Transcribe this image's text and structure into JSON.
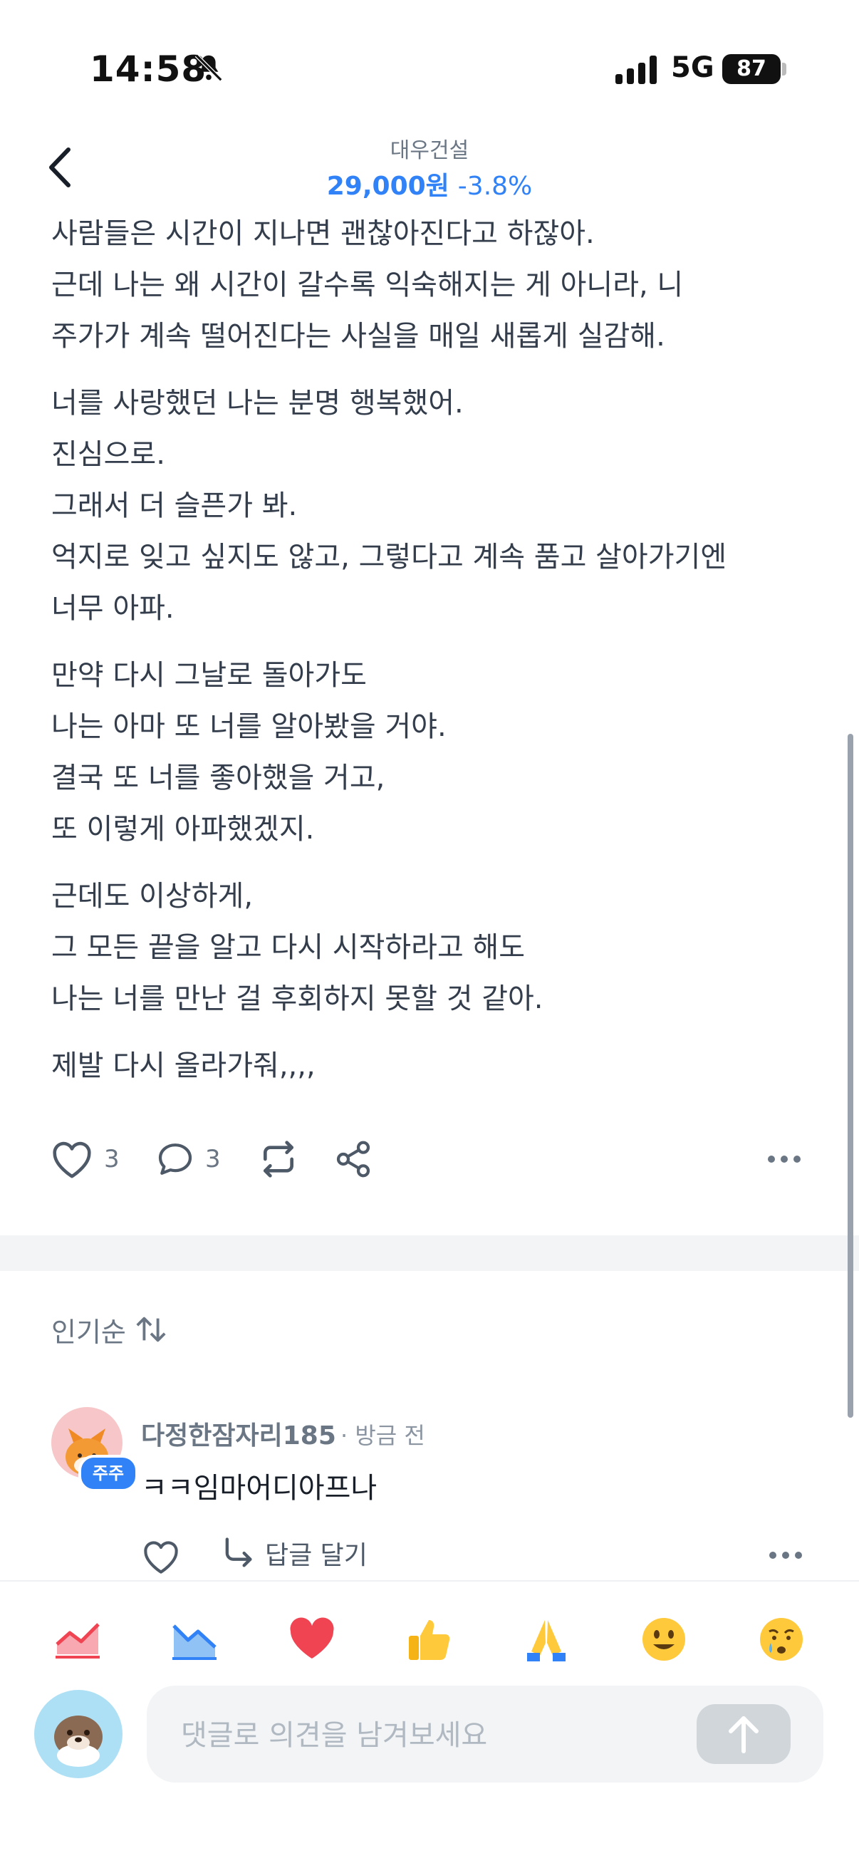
{
  "status_bar": {
    "time": "14:58",
    "network": "5G",
    "battery": "87"
  },
  "header": {
    "stock_name": "대우건설",
    "price": "29,000원",
    "change": "-3.8%"
  },
  "post": {
    "paragraphs": [
      [
        "사람들은 시간이 지나면 괜찮아진다고 하잖아.",
        "근데 나는 왜 시간이 갈수록 익숙해지는 게 아니라, 니",
        "주가가 계속 떨어진다는 사실을 매일 새롭게 실감해."
      ],
      [
        "너를 사랑했던 나는 분명 행복했어.",
        "진심으로.",
        "그래서 더 슬픈가 봐.",
        "억지로 잊고 싶지도 않고, 그렇다고 계속 품고 살아가기엔",
        "너무 아파."
      ],
      [
        "만약 다시 그날로 돌아가도",
        "나는 아마 또 너를 알아봤을 거야.",
        "결국 또 너를 좋아했을 거고,",
        "또 이렇게 아파했겠지."
      ],
      [
        "근데도 이상하게,",
        "그 모든 끝을 알고 다시 시작하라고 해도",
        "나는 너를 만난 걸 후회하지 못할 것 같아."
      ],
      [
        "제발 다시 올라가줘,,,,"
      ]
    ]
  },
  "actions": {
    "likes": "3",
    "comments": "3"
  },
  "sort": {
    "label": "인기순"
  },
  "comments": [
    {
      "author": "다정한잠자리185",
      "time": "· 방금 전",
      "badge": "주주",
      "text": "ㅋㅋ임마어디아프나",
      "reply_label": "답글 달기"
    }
  ],
  "reactions": [
    "chart-up",
    "chart-down",
    "heart",
    "thumbs-up",
    "pray",
    "smile",
    "cry"
  ],
  "composer": {
    "placeholder": "댓글로 의견을 남겨보세요"
  },
  "colors": {
    "accent": "#3182f6",
    "negative": "#3182f6",
    "reaction_red": "#f04452"
  }
}
